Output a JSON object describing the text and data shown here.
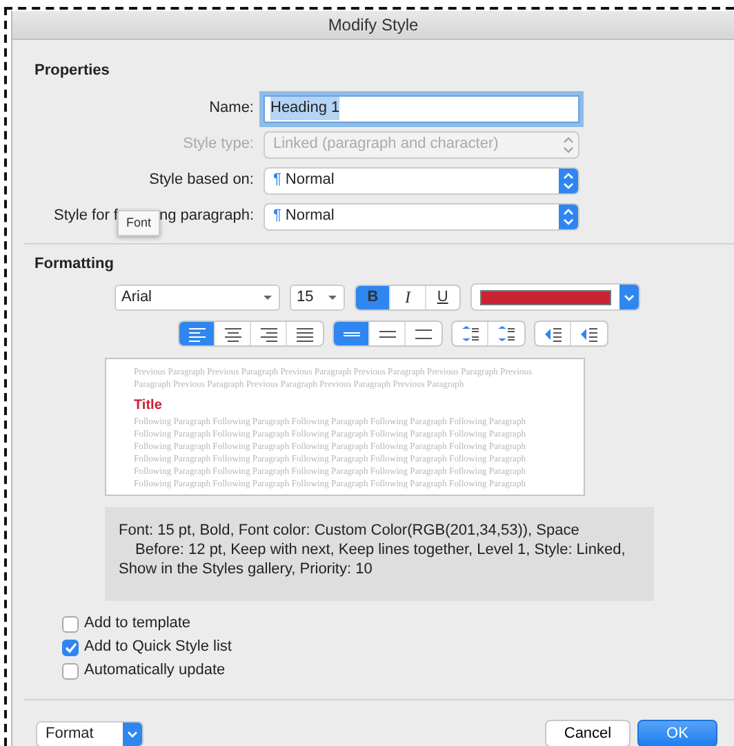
{
  "window": {
    "title": "Modify Style"
  },
  "properties": {
    "heading": "Properties",
    "fields": [
      {
        "kind": "text",
        "label": "Name:",
        "value": "Heading 1",
        "disabled": false
      },
      {
        "kind": "select",
        "label": "Style type:",
        "value": "Linked (paragraph and character)",
        "disabled": true
      },
      {
        "kind": "select",
        "label": "Style based on:",
        "mark": "¶",
        "value": "Normal",
        "disabled": false
      },
      {
        "kind": "select",
        "label": "Style for f",
        "label_rest": "ng paragraph:",
        "tooltip": "Font",
        "mark": "¶",
        "value": "Normal",
        "disabled": false
      }
    ]
  },
  "formatting": {
    "heading": "Formatting",
    "font": "Arial",
    "size": "15",
    "styles": [
      {
        "label": "B",
        "kind": "bold",
        "selected": true
      },
      {
        "label": "I",
        "kind": "italic",
        "selected": false
      },
      {
        "label": "U",
        "kind": "underline",
        "selected": false
      }
    ],
    "color": "#c92235",
    "toolbar": [
      [
        {
          "kind": "align-left",
          "selected": true
        },
        {
          "kind": "align-center",
          "selected": false
        },
        {
          "kind": "align-right",
          "selected": false
        },
        {
          "kind": "justify",
          "selected": false
        }
      ],
      [
        {
          "kind": "single",
          "selected": true
        },
        {
          "kind": "one-half",
          "selected": false
        },
        {
          "kind": "double",
          "selected": false
        }
      ],
      [
        {
          "kind": "space-less",
          "selected": false
        },
        {
          "kind": "space-more",
          "selected": false
        }
      ],
      [
        {
          "kind": "outdent",
          "selected": false
        },
        {
          "kind": "indent",
          "selected": false
        }
      ]
    ]
  },
  "preview": {
    "previous": "Previous Paragraph Previous Paragraph Previous Paragraph Previous Paragraph Previous Paragraph Previous Paragraph Previous Paragraph Previous Paragraph Previous Paragraph Previous Paragraph",
    "title": "Title",
    "following": [
      "Following Paragraph Following Paragraph Following Paragraph Following Paragraph Following Paragraph",
      "Following Paragraph Following Paragraph Following Paragraph Following Paragraph Following Paragraph",
      "Following Paragraph Following Paragraph Following Paragraph Following Paragraph Following Paragraph",
      "Following Paragraph Following Paragraph Following Paragraph Following Paragraph Following Paragraph",
      "Following Paragraph Following Paragraph Following Paragraph Following Paragraph Following Paragraph",
      "Following Paragraph Following Paragraph Following Paragraph Following Paragraph Following Paragraph"
    ]
  },
  "description": [
    "Font: 15 pt, Bold, Font color: Custom Color(RGB(201,34,53)), Space",
    "Before:  12 pt, Keep with next, Keep lines together, Level 1, Style: Linked,",
    "Show in the Styles gallery, Priority: 10"
  ],
  "options": [
    {
      "label": "Add to template",
      "checked": false
    },
    {
      "label": "Add to Quick Style list",
      "checked": true
    },
    {
      "label": "Automatically update",
      "checked": false
    }
  ],
  "buttons": {
    "format": "Format",
    "cancel": "Cancel",
    "ok": "OK"
  }
}
